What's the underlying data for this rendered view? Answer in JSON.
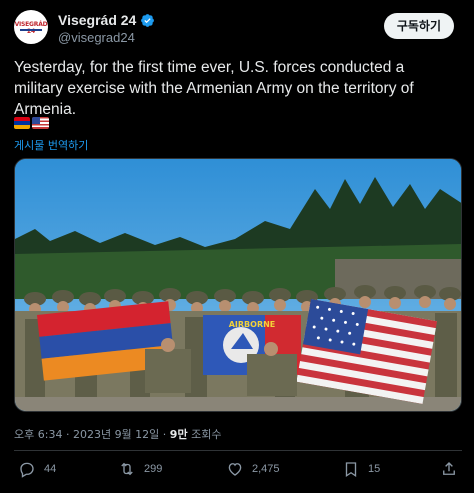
{
  "account": {
    "display_name": "Visegrád 24",
    "handle": "@visegrad24",
    "avatar_label": "VISEGRÁD 24"
  },
  "subscribe_button": "구독하기",
  "tweet": {
    "text": "Yesterday, for the first time ever, U.S. forces conducted a military exercise with the Armenian Army on the territory of Armenia.",
    "flags": [
      "armenia-flag",
      "usa-flag"
    ],
    "translate_link": "게시물 번역하기",
    "photo_banner": "AIRBORNE"
  },
  "meta": {
    "time": "오후 6:34",
    "separator": " · ",
    "date": "2023년 9월 12일",
    "views_count": "9만",
    "views_label": " 조회수"
  },
  "actions": {
    "replies": "44",
    "retweets": "299",
    "likes": "2,475",
    "bookmarks": "15"
  },
  "colors": {
    "background": "#000000",
    "text": "#e7e9ea",
    "muted": "#8b98a5",
    "link": "#1d9bf0",
    "verified": "#1d9bf0"
  }
}
